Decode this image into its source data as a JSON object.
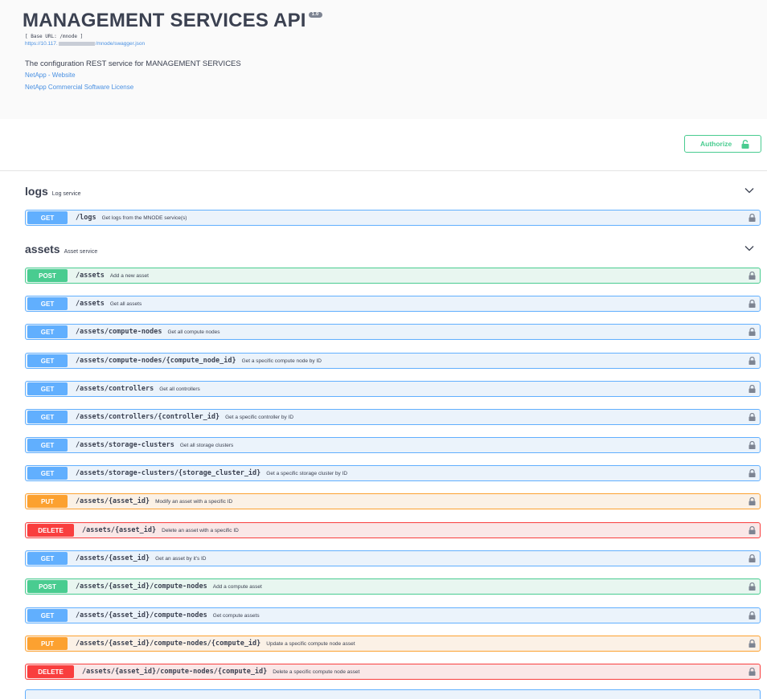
{
  "info": {
    "title": "MANAGEMENT SERVICES API",
    "version": "1.0",
    "base_url": "[ Base URL: /mnode ]",
    "spec_url_start": "https://10.117.",
    "spec_url_end": "/mnode/swagger.json",
    "description": "The configuration REST service for MANAGEMENT SERVICES",
    "website_link": "NetApp - Website",
    "license_link": "NetApp Commercial Software License"
  },
  "authorize": {
    "label": "Authorize"
  },
  "tags": [
    {
      "name": "logs",
      "description": "Log service"
    },
    {
      "name": "assets",
      "description": "Asset service"
    }
  ],
  "operations": [
    {
      "method": "GET",
      "path": "/logs",
      "summary": "Get logs from the MNODE service(s)"
    },
    {
      "method": "POST",
      "path": "/assets",
      "summary": "Add a new asset"
    },
    {
      "method": "GET",
      "path": "/assets",
      "summary": "Get all assets"
    },
    {
      "method": "GET",
      "path": "/assets/compute-nodes",
      "summary": "Get all compute nodes"
    },
    {
      "method": "GET",
      "path": "/assets/compute-nodes/{compute_node_id}",
      "summary": "Get a specific compute node by ID"
    },
    {
      "method": "GET",
      "path": "/assets/controllers",
      "summary": "Get all controllers"
    },
    {
      "method": "GET",
      "path": "/assets/controllers/{controller_id}",
      "summary": "Get a specific controller by ID"
    },
    {
      "method": "GET",
      "path": "/assets/storage-clusters",
      "summary": "Get all storage clusters"
    },
    {
      "method": "GET",
      "path": "/assets/storage-clusters/{storage_cluster_id}",
      "summary": "Get a specific storage cluster by ID"
    },
    {
      "method": "PUT",
      "path": "/assets/{asset_id}",
      "summary": "Modify an asset with a specific ID"
    },
    {
      "method": "DELETE",
      "path": "/assets/{asset_id}",
      "summary": "Delete an asset with a specific ID"
    },
    {
      "method": "GET",
      "path": "/assets/{asset_id}",
      "summary": "Get an asset by it's ID"
    },
    {
      "method": "POST",
      "path": "/assets/{asset_id}/compute-nodes",
      "summary": "Add a compute asset"
    },
    {
      "method": "GET",
      "path": "/assets/{asset_id}/compute-nodes",
      "summary": "Get compute assets"
    },
    {
      "method": "PUT",
      "path": "/assets/{asset_id}/compute-nodes/{compute_id}",
      "summary": "Update a specific compute node asset"
    },
    {
      "method": "DELETE",
      "path": "/assets/{asset_id}/compute-nodes/{compute_id}",
      "summary": "Delete a specific compute node asset"
    }
  ],
  "colors": {
    "get": "#61affe",
    "post": "#49cc90",
    "put": "#fca130",
    "delete": "#f93e3e",
    "link": "#4990e2"
  },
  "icons": {
    "lock": "lock-icon",
    "expand": "chevron-down-icon"
  }
}
